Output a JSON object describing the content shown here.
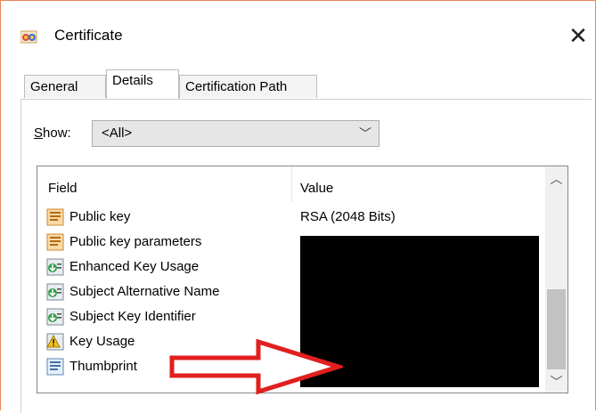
{
  "window": {
    "title": "Certificate",
    "close_glyph": "✕",
    "border_color": "#e8855b"
  },
  "tabs": [
    {
      "label": "General",
      "active": false
    },
    {
      "label": "Details",
      "active": true
    },
    {
      "label": "Certification Path",
      "active": false
    }
  ],
  "show": {
    "label_first": "S",
    "label_rest": "how:",
    "selected": "<All>"
  },
  "list": {
    "columns": [
      "Field",
      "Value"
    ],
    "rows": [
      {
        "field": "Public key",
        "value": "RSA (2048 Bits)",
        "icon": "certificate-field-icon"
      },
      {
        "field": "Public key parameters",
        "value": "",
        "icon": "certificate-field-icon"
      },
      {
        "field": "Enhanced Key Usage",
        "value": "",
        "icon": "extension-icon"
      },
      {
        "field": "Subject Alternative Name",
        "value": "",
        "icon": "extension-icon"
      },
      {
        "field": "Subject Key Identifier",
        "value": "",
        "icon": "extension-icon"
      },
      {
        "field": "Key Usage",
        "value": "",
        "icon": "critical-extension-icon"
      },
      {
        "field": "Thumbprint",
        "value": "",
        "icon": "thumbprint-icon"
      }
    ]
  },
  "annotation": {
    "arrow_color": "#e01f1f"
  }
}
